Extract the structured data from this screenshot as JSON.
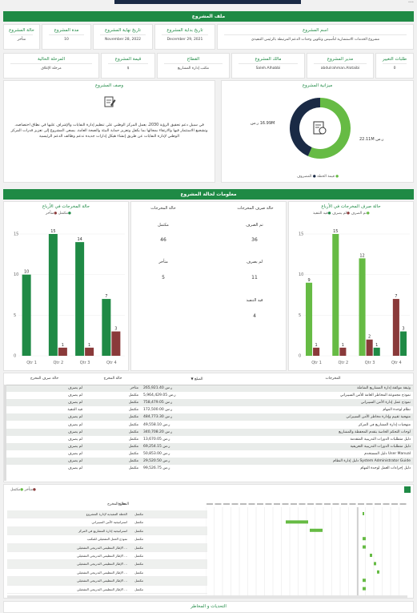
{
  "colors": {
    "green": "#1f8a45",
    "lightgreen": "#66bb44",
    "maroon": "#8a3a3a",
    "navy": "#1a2a45",
    "teal": "#2aa566"
  },
  "header": {
    "project_file": "ملف المشروع"
  },
  "info_row1": [
    {
      "key": "اسم المشروع",
      "value": "مشروع الخدمات الاستشارية لتأسيس وتكوين وحدات الدعم المرتبطة بالرئيس التنفيذي"
    },
    {
      "key": "تاريخ بداية المشروع",
      "value": "December 29, 2021"
    },
    {
      "key": "تاريخ نهاية المشروع",
      "value": "November 28, 2022"
    },
    {
      "key": "مدة المشروع",
      "value": "10"
    },
    {
      "key": "حالة المشروع",
      "value": "متأخر"
    }
  ],
  "info_row2": [
    {
      "key": "طلبات التغيير",
      "value": "0"
    },
    {
      "key": "مدير المشروع",
      "value": "abdulrahman.Alotaibi"
    },
    {
      "key": "مالك المشروع",
      "value": "Saleh.Alhabbi"
    },
    {
      "key": "القطاع",
      "value": "مكتب إدارة المشاريع"
    },
    {
      "key": "قيمة المشروع",
      "value": "$"
    },
    {
      "key": "المرحلة الحالية",
      "value": "مرحلة الإغلاق"
    }
  ],
  "description": {
    "title": "وصف المشروع",
    "text": "في سبيل دعم تحقيق الرؤية 2030، يعمل المركز الوطني على تنظيم إدارة النفايات والإشراف عليها في نطاق اختصاصه، وتشجيع الاستثمار فيها والارتقاء بمجالها بما يكفل وتعزيز حماية البيئة والصحة العامة. يسعى المشروع إلى تعزيز قدرات المركز الوطني لإدارة النفايات عن طريق إنشاء هيكل إدارات جديدة تدعم وظائف الدعم الرئيسية"
  },
  "budget": {
    "title": "ميزانية المشروع",
    "label_left": "16.99M ر.س",
    "label_right": "ر.س 22.11M",
    "legend": [
      "المصروف",
      "قيمة الخطة"
    ]
  },
  "deliverables_header": "معلومات لحالة المشروع",
  "chart_right": {
    "title": "حالة صرف المخرجات في الأرباع",
    "legend": [
      "تم الصرف",
      "لم يصرف",
      "قيد التنفيذ"
    ]
  },
  "chart_left": {
    "title": "حالة المخرجات في الأرباع",
    "legend": [
      "مكتمل",
      "متأخر"
    ]
  },
  "summary": {
    "col_right_title": "حالة صرف المخرجات",
    "col_left_title": "حالة المخرجات",
    "items_right": [
      {
        "label": "تم الصرف",
        "value": "36"
      },
      {
        "label": "لم يصرف",
        "value": "11"
      },
      {
        "label": "قيد التنفيذ",
        "value": "4"
      }
    ],
    "items_left": [
      {
        "label": "مكتمل",
        "value": "46"
      },
      {
        "label": "متأخر",
        "value": "5"
      }
    ]
  },
  "table": {
    "headers": [
      "المخرجات",
      "المبلغ",
      "حالة المخرج",
      "حالة صرف المخرج"
    ],
    "rows": [
      [
        "وثيقة مواثقة إدارة المشاريع الشاملة",
        "ر.س 265,921.40",
        "متأخر",
        "لم يصرف"
      ],
      [
        "نموذج مجموعة المخاطر العامة للأمن السيبراني",
        "ر.س 5,964,429.05",
        "مكتمل",
        "لم يصرف"
      ],
      [
        "نموذج عمل إدارة الأمن السيبراني",
        "ر.س 758,479.05",
        "مكتمل",
        "لم يصرف"
      ],
      [
        "نظام لوحدة المهام",
        "ر.س 172,500.00",
        "مكتمل",
        "قيد التنفيذ"
      ],
      [
        "منهجية تقييم وإدارة مخاطر الأمن السيبراني",
        "ر.س 484,773.30",
        "مكتمل",
        "لم يصرف"
      ],
      [
        "منهجيات إدارة المشاريع في المركز",
        "ر.س 49,558.10",
        "مكتمل",
        "لم يصرف"
      ],
      [
        "لوحات التحكم الخاصة بتقدم المحفظة والمشاريع",
        "ر.س 340,708.20",
        "مكتمل",
        "لم يصرف"
      ],
      [
        "دليل متطلبات الدورات التدريبية المتقدمة",
        "ر.س 13,670.05",
        "مكتمل",
        "لم يصرف"
      ],
      [
        "دليل متطلبات الدورات التدريبية التعريفية",
        "ر.س 69,254.15",
        "مكتمل",
        "لم يصرف"
      ],
      [
        "User Manual دليل المستخدم",
        "ر.س 50,853.00",
        "مكتمل",
        "لم يصرف"
      ],
      [
        "System Administrator Guide دليل إدارة النظام",
        "ر.س 29,520.50",
        "مكتمل",
        "لم يصرف"
      ],
      [
        "دليل إجراءات العمل لوحدة المهام",
        "ر.س 99,526.75",
        "مكتمل",
        "لم يصرف"
      ]
    ]
  },
  "gantt": {
    "legend": [
      "مكتمل",
      "متأخر"
    ],
    "col_name": "المخرج",
    "col_status": "حالة المخرج",
    "rows": [
      {
        "name": "الخطة التنفيذية لإدارة المشروع",
        "status": "مكتمل"
      },
      {
        "name": "استراتيجية الأمن السيبراني",
        "status": "مكتمل"
      },
      {
        "name": "استراتيجية إدارة المشاريع في المركز",
        "status": "مكتمل"
      },
      {
        "name": "نموذج العمل التشغيلي للمكتب",
        "status": "مكتمل"
      },
      {
        "name": "... الإطار التنظيمي التدريجي التشغيلي",
        "status": "مكتمل"
      },
      {
        "name": "... الإطار التنظيمي التدريجي التشغيلي",
        "status": "مكتمل"
      },
      {
        "name": "... الإطار التنظيمي التدريجي التشغيلي",
        "status": "مكتمل"
      },
      {
        "name": "... الإطار التنظيمي التدريجي التشغيلي",
        "status": "مكتمل"
      },
      {
        "name": "... الإطار التنظيمي التدريجي التشغيلي",
        "status": "مكتمل"
      },
      {
        "name": "... الإطار التنظيمي التدريجي التشغيلي",
        "status": "مكتمل"
      }
    ]
  },
  "footer": {
    "risks_title": "التحديات و المخاطر"
  },
  "chart_data": [
    {
      "type": "bar",
      "title": "حالة صرف المخرجات في الأرباع",
      "categories": [
        "Qtr 1",
        "Qtr 2",
        "Qtr 3",
        "Qtr 4"
      ],
      "ylim": [
        0,
        15
      ],
      "yticks": [
        0,
        5,
        10,
        15
      ],
      "series": [
        {
          "name": "قيد التنفيذ",
          "color": "#66bb44",
          "values": [
            9,
            15,
            12,
            null
          ]
        },
        {
          "name": "لم يصرف",
          "color": "#8a3a3a",
          "values": [
            1,
            1,
            2,
            7
          ]
        },
        {
          "name": "تم الصرف",
          "color": "#1f8a45",
          "values": [
            null,
            null,
            1,
            3
          ]
        }
      ]
    },
    {
      "type": "bar",
      "title": "حالة المخرجات في الأرباع",
      "categories": [
        "Qtr 1",
        "Qtr 2",
        "Qtr 3",
        "Qtr 4"
      ],
      "ylim": [
        0,
        15
      ],
      "yticks": [
        0,
        5,
        10,
        15
      ],
      "series": [
        {
          "name": "مكتمل",
          "color": "#1f8a45",
          "values": [
            10,
            15,
            14,
            7
          ]
        },
        {
          "name": "متأخر",
          "color": "#8a3a3a",
          "values": [
            null,
            1,
            1,
            3
          ]
        }
      ]
    },
    {
      "type": "pie",
      "title": "ميزانية المشروع",
      "slices": [
        {
          "name": "قيمة الخطة",
          "value": 22.11,
          "color": "#66bb44"
        },
        {
          "name": "المصروف",
          "value": 16.99,
          "color": "#1a2a45"
        }
      ]
    }
  ]
}
